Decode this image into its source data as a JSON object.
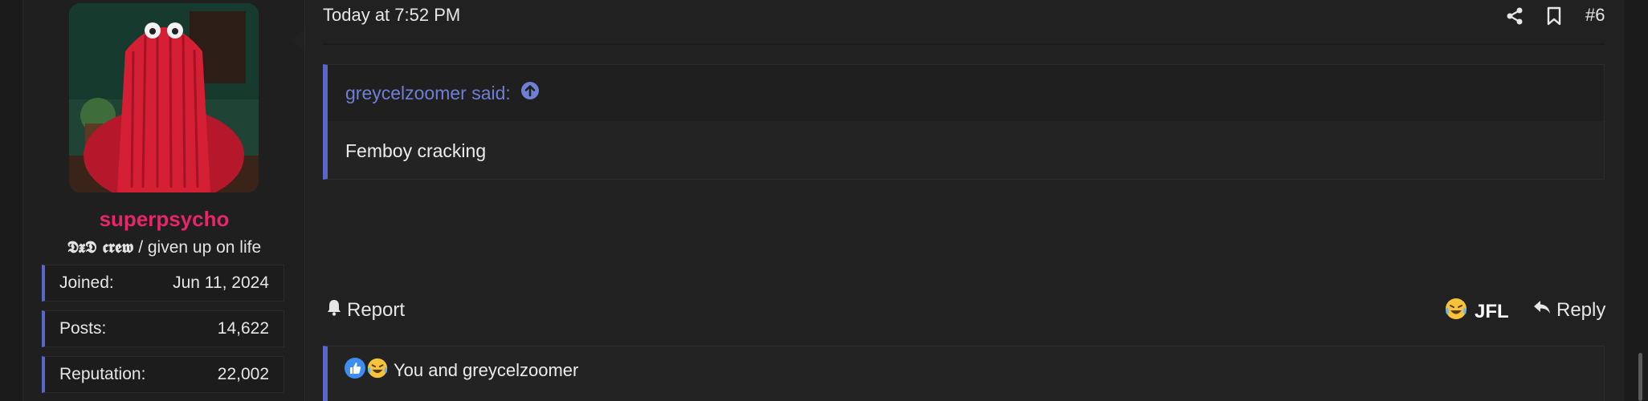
{
  "user": {
    "name": "superpsycho",
    "title_styled": "𝕯𝖝𝕯 𝖈𝖗𝖊𝖜",
    "title_rest": " / given up on life",
    "stats": [
      {
        "label": "Joined:",
        "value": "Jun 11, 2024"
      },
      {
        "label": "Posts:",
        "value": "14,622"
      },
      {
        "label": "Reputation:",
        "value": "22,002"
      }
    ]
  },
  "post": {
    "date": "Today at 7:52 PM",
    "number": "#6",
    "quote": {
      "author_said": "greycelzoomer said:",
      "text": "Femboy cracking"
    },
    "actions": {
      "report": "Report",
      "jfl": "JFL",
      "reply": "Reply"
    },
    "reactions_text": "You and greycelzoomer"
  },
  "colors": {
    "accent": "#5a66c8",
    "username": "#e8256b",
    "quote_link": "#6f7fd6",
    "background": "#212121"
  }
}
